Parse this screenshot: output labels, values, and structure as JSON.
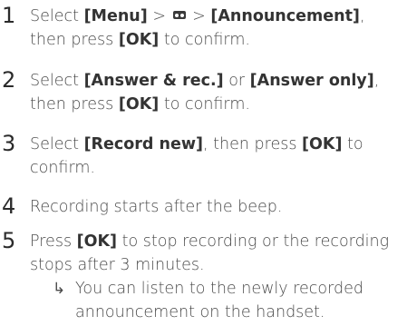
{
  "steps": [
    {
      "number": "1",
      "pre": "Select ",
      "b1": "[Menu]",
      "sep1": " > ",
      "icon": "tape-icon",
      "sep2": " > ",
      "b2": "[Announcement]",
      "mid": ", then press ",
      "b3": "[OK]",
      "post": " to confirm."
    },
    {
      "number": "2",
      "pre": "Select ",
      "b1": "[Answer & rec.]",
      "mid1": " or ",
      "b2": "[Answer only]",
      "mid2": ", then press ",
      "b3": "[OK]",
      "post": " to confirm."
    },
    {
      "number": "3",
      "pre": "Select ",
      "b1": "[Record new]",
      "mid": ", then press ",
      "b2": "[OK]",
      "post": " to confirm."
    },
    {
      "number": "4",
      "text": "Recording starts after the beep."
    },
    {
      "number": "5",
      "pre": "Press ",
      "b1": "[OK]",
      "post": " to stop recording or the recording stops after 3 minutes."
    }
  ],
  "result": {
    "arrow": "↳",
    "text": "You can listen to the newly recorded announcement on the handset."
  }
}
